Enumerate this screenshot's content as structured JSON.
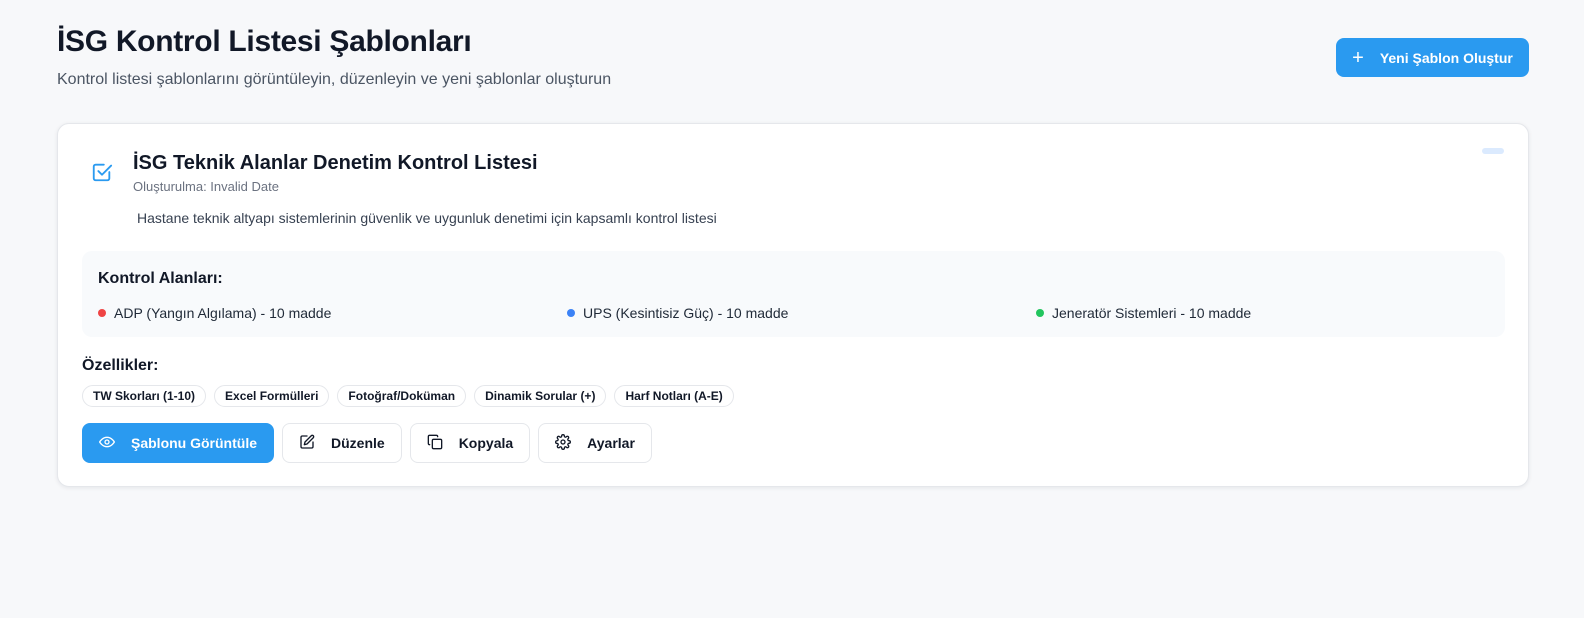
{
  "header": {
    "title": "İSG Kontrol Listesi Şablonları",
    "subtitle": "Kontrol listesi şablonlarını görüntüleyin, düzenleyin ve yeni şablonlar oluşturun",
    "new_button_label": "Yeni Şablon Oluştur",
    "new_button_icon": "plus-icon"
  },
  "template_card": {
    "icon": "checkbox-icon",
    "title": "İSG Teknik Alanlar Denetim Kontrol Listesi",
    "created": "Oluşturulma: Invalid Date",
    "description": "Hastane teknik altyapı sistemlerinin güvenlik ve uygunluk denetimi için kapsamlı kontrol listesi",
    "areas_title": "Kontrol Alanları:",
    "areas": [
      {
        "label": "ADP (Yangın Algılama) - 10 madde",
        "color": "#ef4444"
      },
      {
        "label": "UPS (Kesintisiz Güç) - 10 madde",
        "color": "#3b82f6"
      },
      {
        "label": "Jeneratör Sistemleri - 10 madde",
        "color": "#22c55e"
      }
    ],
    "features_title": "Özellikler:",
    "features": [
      "TW Skorları (1-10)",
      "Excel Formülleri",
      "Fotoğraf/Doküman",
      "Dinamik Sorular (+)",
      "Harf Notları (A-E)"
    ],
    "actions": [
      {
        "label": "Şablonu Görüntüle",
        "icon": "eye-icon"
      },
      {
        "label": "Düzenle",
        "icon": "edit-icon"
      },
      {
        "label": "Kopyala",
        "icon": "copy-icon"
      },
      {
        "label": "Ayarlar",
        "icon": "gear-icon"
      }
    ]
  },
  "colors": {
    "accent": "#2a9af0",
    "background": "#f7f8fa"
  }
}
